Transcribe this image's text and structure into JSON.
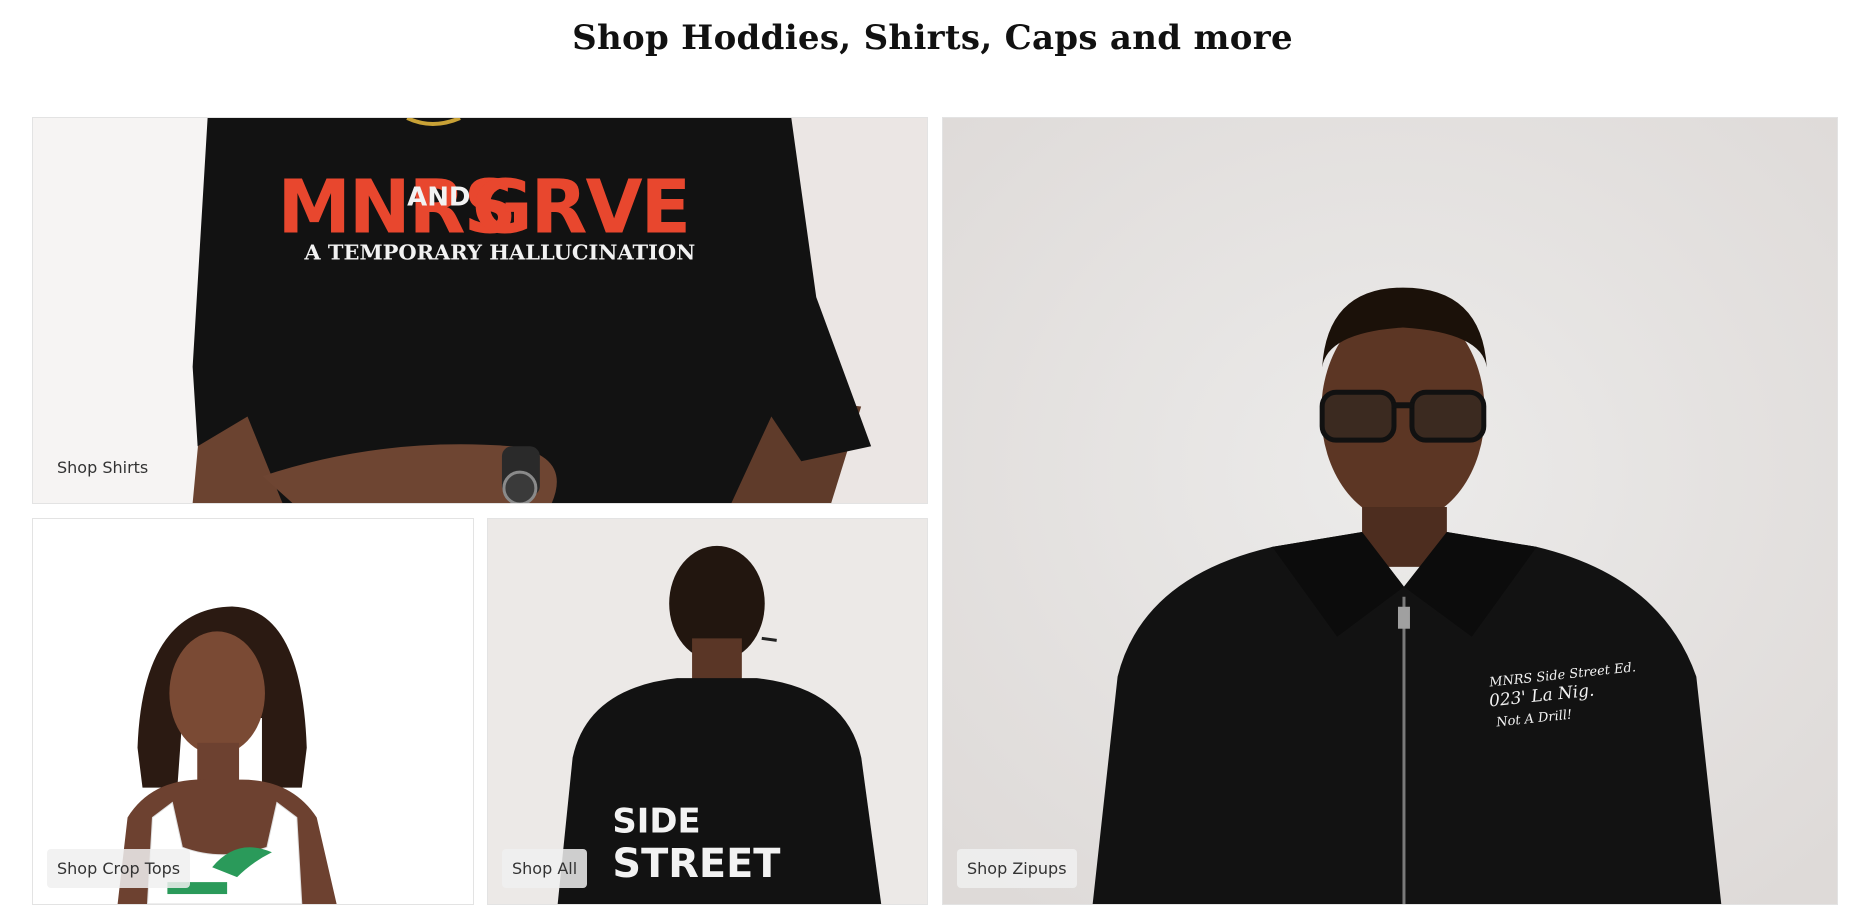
{
  "page": {
    "heading": "Shop Hoddies, Shirts, Caps and more"
  },
  "tiles": {
    "shirts": {
      "label": "Shop Shirts",
      "graphic": {
        "print_main_left": "MNRS",
        "print_main_mid": "AND",
        "print_main_right": "GRVE",
        "print_sub": "A TEMPORARY HALLUCINATION"
      }
    },
    "croptops": {
      "label": "Shop Crop Tops"
    },
    "all": {
      "label": "Shop All",
      "graphic": {
        "print_top": "SIDE",
        "print_bottom": "STREET"
      }
    },
    "zipups": {
      "label": "Shop Zipups",
      "graphic": {
        "line1": "MNRS Side Street Ed.",
        "line2": "023' La Nig.",
        "line3": "Not A Drill!"
      }
    }
  },
  "colors": {
    "shirt_print_red": "#e8472e",
    "print_white": "#f2f2f2",
    "garment_black": "#121212",
    "skin": "#6b4330",
    "green_print": "#2a9a5a"
  }
}
